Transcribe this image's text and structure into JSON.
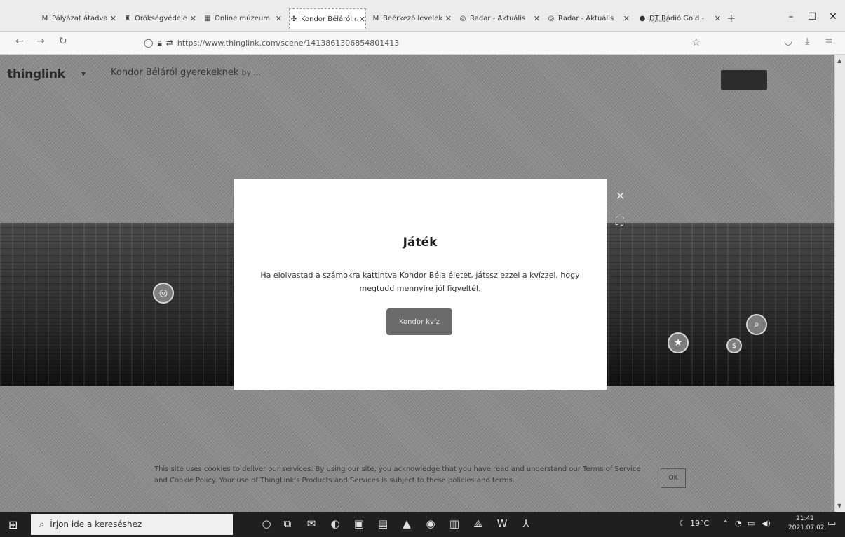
{
  "browser": {
    "tabs": [
      {
        "icon": "mail-icon",
        "glyph": "M",
        "title": "Pályázat átadva -",
        "active": false
      },
      {
        "icon": "shield-tab-icon",
        "glyph": "♜",
        "title": "Örökségvédelem",
        "active": false
      },
      {
        "icon": "museum-icon",
        "glyph": "▦",
        "title": "Online múzeum",
        "active": false
      },
      {
        "icon": "thinglink-icon",
        "glyph": "✣",
        "title": "Kondor Béláról g",
        "active": true
      },
      {
        "icon": "mail-icon",
        "glyph": "M",
        "title": "Beérkező levelek",
        "active": false
      },
      {
        "icon": "radar-icon",
        "glyph": "◎",
        "title": "Radar - Aktuális",
        "active": false
      },
      {
        "icon": "radar-icon",
        "glyph": "◎",
        "title": "Radar - Aktuális",
        "active": false
      },
      {
        "icon": "radio-icon",
        "glyph": "●",
        "title": "DT Rádió Gold -",
        "active": false
      }
    ],
    "tab_subtext": "LEJÁTSZÁS",
    "url": "https://www.thinglink.com/scene/1413861306854801413"
  },
  "page": {
    "logo": "thinglink",
    "scene_title": "Kondor Béláról gyerekeknek",
    "scene_by": "by ...",
    "modal": {
      "title": "Játék",
      "text": "Ha elolvastad a számokra kattintva Kondor Béla életét, játssz ezzel a kvízzel, hogy megtudd mennyire jól figyeltél.",
      "button": "Kondor kvíz"
    },
    "cookie_text": "This site uses cookies to deliver our services. By using our site, you acknowledge that you have read and understand our Terms of Service and Cookie Policy. Your use of ThingLink's Products and Services is subject to these policies and terms.",
    "cookie_ok": "OK"
  },
  "taskbar": {
    "search_placeholder": "Írjon ide a kereséshez",
    "temperature": "19°C",
    "time": "21:42",
    "date": "2021.07.02."
  }
}
